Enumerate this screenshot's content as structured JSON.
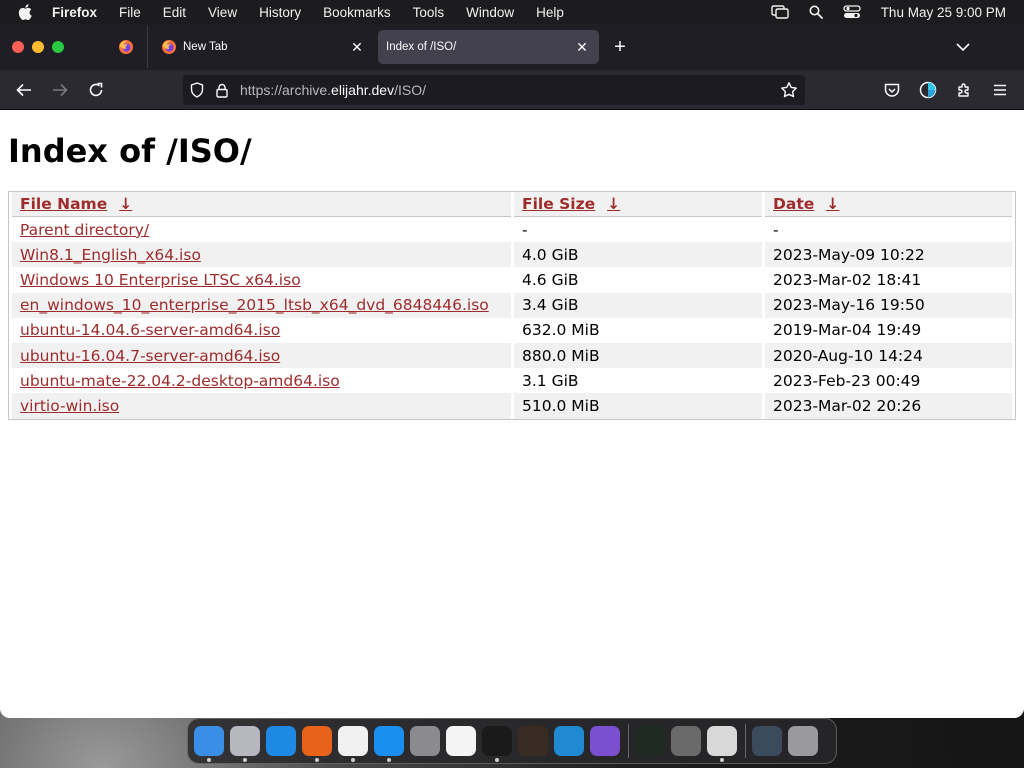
{
  "menubar": {
    "app": "Firefox",
    "items": [
      "File",
      "Edit",
      "View",
      "History",
      "Bookmarks",
      "Tools",
      "Window",
      "Help"
    ],
    "clock": "Thu May 25  9:00 PM",
    "icons": [
      "screen-mirror-icon",
      "spotlight-search-icon",
      "control-center-icon"
    ]
  },
  "browser": {
    "tabs": [
      {
        "label": "New Tab",
        "active": false
      },
      {
        "label": "Index of /ISO/",
        "active": true
      }
    ],
    "url": {
      "scheme": "https://archive.",
      "host": "elijahr.dev",
      "path": "/ISO/"
    }
  },
  "page": {
    "title": "Index of /ISO/",
    "columns": [
      {
        "label": "File Name",
        "arrow": "↓"
      },
      {
        "label": "File Size",
        "arrow": "↓"
      },
      {
        "label": "Date",
        "arrow": "↓"
      }
    ],
    "rows": [
      {
        "name": "Parent directory/",
        "size": "-",
        "date": "-"
      },
      {
        "name": "Win8.1_English_x64.iso",
        "size": "4.0 GiB",
        "date": "2023-May-09 10:22"
      },
      {
        "name": "Windows 10 Enterprise LTSC x64.iso",
        "size": "4.6 GiB",
        "date": "2023-Mar-02 18:41"
      },
      {
        "name": "en_windows_10_enterprise_2015_ltsb_x64_dvd_6848446.iso",
        "size": "3.4 GiB",
        "date": "2023-May-16 19:50"
      },
      {
        "name": "ubuntu-14.04.6-server-amd64.iso",
        "size": "632.0 MiB",
        "date": "2019-Mar-04 19:49"
      },
      {
        "name": "ubuntu-16.04.7-server-amd64.iso",
        "size": "880.0 MiB",
        "date": "2020-Aug-10 14:24"
      },
      {
        "name": "ubuntu-mate-22.04.2-desktop-amd64.iso",
        "size": "3.1 GiB",
        "date": "2023-Feb-23 00:49"
      },
      {
        "name": "virtio-win.iso",
        "size": "510.0 MiB",
        "date": "2023-Mar-02 20:26"
      }
    ]
  },
  "colors": {
    "link": "#9e2c2c",
    "tabbar_bg": "#1f1e25",
    "navbar_bg": "#2b2a33",
    "active_tab_bg": "#42414d"
  },
  "dock": [
    {
      "name": "finder-icon",
      "color": "#3a8ee6",
      "running": true
    },
    {
      "name": "launchpad-icon",
      "color": "#b7b7c0",
      "running": true
    },
    {
      "name": "safari-icon",
      "color": "#1e88e5",
      "running": false
    },
    {
      "name": "firefox-icon",
      "color": "#e8621a",
      "running": true
    },
    {
      "name": "chrome-icon",
      "color": "#f1f1f1",
      "running": true
    },
    {
      "name": "app-store-icon",
      "color": "#1a8ff0",
      "running": true
    },
    {
      "name": "system-settings-icon",
      "color": "#8a8a8f",
      "running": false
    },
    {
      "name": "textedit-icon",
      "color": "#f4f4f4",
      "running": false
    },
    {
      "name": "terminal-icon",
      "color": "#1a1a1a",
      "running": true
    },
    {
      "name": "garageband-icon",
      "color": "#3a2c22",
      "running": false
    },
    {
      "name": "vscode-icon",
      "color": "#1f8ad2",
      "running": false
    },
    {
      "name": "visual-studio-icon",
      "color": "#7b4fcf",
      "running": false
    },
    {
      "name": "activity-monitor-icon",
      "color": "#1f2a22",
      "running": false
    },
    {
      "name": "chess-icon",
      "color": "#6a6a6a",
      "running": false
    },
    {
      "name": "disk-utility-icon",
      "color": "#d8d8d8",
      "running": true
    },
    {
      "name": "downloads-stack-icon",
      "color": "#3b4a5c",
      "running": false
    },
    {
      "name": "trash-icon",
      "color": "#9a9a9e",
      "running": false
    }
  ]
}
